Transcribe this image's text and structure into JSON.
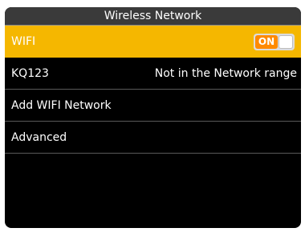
{
  "header": {
    "title": "Wireless Network"
  },
  "rows": [
    {
      "label": "WIFI",
      "toggle_text": "ON"
    },
    {
      "label": "KQ123",
      "value": "Not in the Network range"
    },
    {
      "label": "Add WIFI Network"
    },
    {
      "label": "Advanced"
    }
  ],
  "colors": {
    "selection": "#f5b700",
    "toggle_on": "#ff8a00",
    "background": "#000000"
  }
}
